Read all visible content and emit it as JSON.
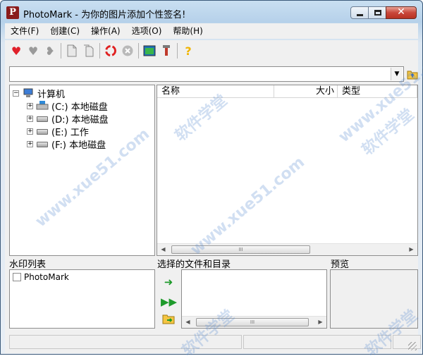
{
  "window": {
    "app_icon_letter": "P",
    "title": "PhotoMark - 为你的图片添加个性签名!"
  },
  "menubar": {
    "items": [
      "文件(F)",
      "创建(C)",
      "操作(A)",
      "选项(O)",
      "帮助(H)"
    ]
  },
  "toolbar": {
    "icons": [
      "heart-red-icon",
      "heart-gray-icon",
      "heart-broken-icon",
      "page-add-icon",
      "page-copy-icon",
      "refresh-icon",
      "cancel-icon",
      "window-icon",
      "tools-icon",
      "help-icon"
    ]
  },
  "pathbar": {
    "value": ""
  },
  "tree": {
    "root": {
      "label": "计算机",
      "expander": "−"
    },
    "drives": [
      {
        "label": "(C:)  本地磁盘",
        "expander": "+"
      },
      {
        "label": "(D:)  本地磁盘",
        "expander": "+"
      },
      {
        "label": "(E:)  工作",
        "expander": "+"
      },
      {
        "label": "(F:)  本地磁盘",
        "expander": "+"
      }
    ]
  },
  "filelist": {
    "columns": [
      "名称",
      "大小",
      "类型"
    ]
  },
  "panels": {
    "watermark_list_title": "水印列表",
    "watermark_items": [
      "PhotoMark"
    ],
    "selected_files_title": "选择的文件和目录",
    "preview_title": "预览"
  },
  "scroll": {
    "thumb_glyph": "III"
  },
  "watermarks": [
    "www.xue51.com",
    "软件学堂"
  ],
  "colors": {
    "accent": "#1e9a2b",
    "title_gradient_top": "#c9dff1"
  }
}
